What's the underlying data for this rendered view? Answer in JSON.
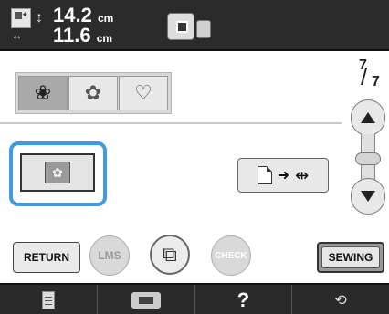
{
  "header": {
    "height_value": "14.2",
    "height_unit": "cm",
    "width_value": "11.6",
    "width_unit": "cm",
    "size_icon": "embroidery-size-icon",
    "frame_icon": "embroidery-frame-icon"
  },
  "palette": {
    "items": [
      {
        "name": "pattern-color-icon",
        "glyph": "❀",
        "selected": true
      },
      {
        "name": "pattern-outline-icon",
        "glyph": "✿",
        "selected": false
      },
      {
        "name": "pattern-light-icon",
        "glyph": "♡",
        "selected": false
      }
    ]
  },
  "page_indicator": {
    "current": "7",
    "total": "7"
  },
  "buttons": {
    "return_label": "RETURN",
    "lms_label": "LMS",
    "check_label": "CHECK",
    "sewing_label": "SEWING",
    "mirror_glyph": "⧉"
  },
  "usb_button": {
    "arrow": "➜",
    "usb": "⇹"
  },
  "bottom_bar": {
    "help_label": "?",
    "settings_glyph": "⟲"
  },
  "colors": {
    "highlight": "#3f9adf",
    "bar": "#2a2a2a"
  }
}
